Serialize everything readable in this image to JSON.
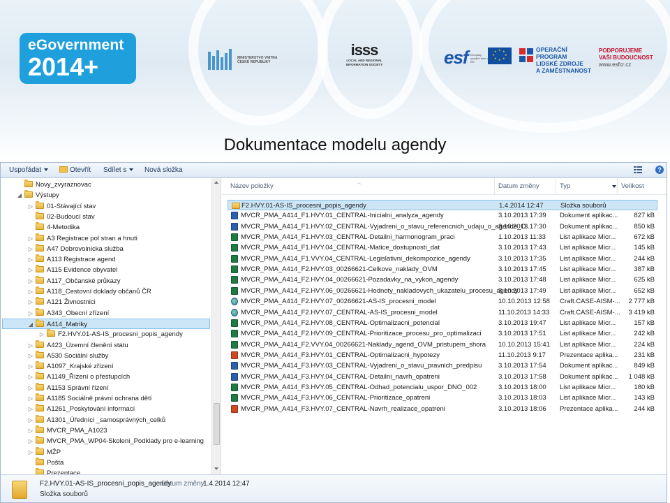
{
  "slide": {
    "title": "Dokumentace modelu agendy"
  },
  "logos": {
    "egov_line1": "eGovernment",
    "egov_line2": "2014+",
    "mvcr_text": "MINISTERSTVO VNITRA ČESKÉ REPUBLIKY",
    "isss_title": "isss",
    "isss_sub": "LOCAL AND REGIONAL INFORMATION SOCIETY",
    "esf": "esf",
    "esf_note": "evropský sociální fond v ČR",
    "eu_note": "EVROPSKÁ UNIE",
    "oplzz_line1": "OPERAČNÍ PROGRAM",
    "oplzz_line2": "LIDSKÉ ZDROJE",
    "oplzz_line3": "A ZAMĚSTNANOST",
    "podporujeme_line1": "PODPORUJEME",
    "podporujeme_line2": "VAŠI BUDOUCNOST",
    "podporujeme_web": "www.esfcr.cz"
  },
  "toolbar": {
    "organize": "Uspořádat",
    "open": "Otevřít",
    "share": "Sdílet s",
    "new_folder": "Nová složka",
    "help": "?"
  },
  "nav": {
    "items": [
      {
        "label": "Novy_zvyraznovac",
        "indent": 1,
        "arrow": "",
        "selected": false
      },
      {
        "label": "Výstupy",
        "indent": 1,
        "arrow": "◢",
        "selected": false
      },
      {
        "label": "01-Stávající stav",
        "indent": 2,
        "arrow": "▷",
        "selected": false
      },
      {
        "label": "02-Budoucí stav",
        "indent": 2,
        "arrow": "",
        "selected": false
      },
      {
        "label": "4-Metodika",
        "indent": 2,
        "arrow": "",
        "selected": false
      },
      {
        "label": "A3 Registrace pol stran a hnuti",
        "indent": 2,
        "arrow": "▷",
        "selected": false
      },
      {
        "label": "A47 Dobrovolnicka služba",
        "indent": 2,
        "arrow": "▷",
        "selected": false
      },
      {
        "label": "A113 Registrace agend",
        "indent": 2,
        "arrow": "▷",
        "selected": false
      },
      {
        "label": "A115 Evidence obyvatel",
        "indent": 2,
        "arrow": "▷",
        "selected": false
      },
      {
        "label": "A117_Občanské průkazy",
        "indent": 2,
        "arrow": "▷",
        "selected": false
      },
      {
        "label": "A118_Cestovní doklady občanů ČR",
        "indent": 2,
        "arrow": "▷",
        "selected": false
      },
      {
        "label": "A121 Živnostnici",
        "indent": 2,
        "arrow": "▷",
        "selected": false
      },
      {
        "label": "A343_Obecní zřízení",
        "indent": 2,
        "arrow": "▷",
        "selected": false
      },
      {
        "label": "A414_Matriky",
        "indent": 2,
        "arrow": "◢",
        "selected": true
      },
      {
        "label": "F2.HVY.01-AS-IS_procesni_popis_agendy",
        "indent": 3,
        "arrow": "▷",
        "selected": false
      },
      {
        "label": "A423_Územní členění státu",
        "indent": 2,
        "arrow": "▷",
        "selected": false
      },
      {
        "label": "A530 Sociální služby",
        "indent": 2,
        "arrow": "▷",
        "selected": false
      },
      {
        "label": "A1097_Krajské zřízení",
        "indent": 2,
        "arrow": "▷",
        "selected": false
      },
      {
        "label": "A1149_Řízení o přestupcích",
        "indent": 2,
        "arrow": "▷",
        "selected": false
      },
      {
        "label": "A1153 Správní řízení",
        "indent": 2,
        "arrow": "▷",
        "selected": false
      },
      {
        "label": "A1185 Sociálně právní ochrana dětí",
        "indent": 2,
        "arrow": "▷",
        "selected": false
      },
      {
        "label": "A1261_Poskytování informací",
        "indent": 2,
        "arrow": "▷",
        "selected": false
      },
      {
        "label": "A1301_Úředníci _samosprávných_celků",
        "indent": 2,
        "arrow": "▷",
        "selected": false
      },
      {
        "label": "MVCR_PMA_A1023",
        "indent": 2,
        "arrow": "▷",
        "selected": false
      },
      {
        "label": "MVCR_PMA_WP04-Skoleni_Podklady pro e-learning",
        "indent": 2,
        "arrow": "▷",
        "selected": false
      },
      {
        "label": "MŽP",
        "indent": 2,
        "arrow": "▷",
        "selected": false
      },
      {
        "label": "Pošta",
        "indent": 2,
        "arrow": "",
        "selected": false
      },
      {
        "label": "Prezentace",
        "indent": 2,
        "arrow": "",
        "selected": false
      }
    ]
  },
  "columns": {
    "name": "Název položky",
    "date": "Datum změny",
    "type": "Typ",
    "size": "Velikost"
  },
  "files": [
    {
      "name": "F2.HVY.01-AS-IS_procesni_popis_agendy",
      "date": "1.4.2014 12:47",
      "type": "Složka souborů",
      "size": "",
      "icon": "folder",
      "selected": true
    },
    {
      "name": "MVCR_PMA_A414_F1.HVY.01_CENTRAL-Inicialni_analyza_agendy",
      "date": "3.10.2013 17:39",
      "type": "Dokument aplikac...",
      "size": "827 kB",
      "icon": "doc",
      "selected": false
    },
    {
      "name": "MVCR_PMA_A414_F1.HVY.02_CENTRAL-Vyjadreni_o_stavu_referencnich_udaju_o_agende_O...",
      "date": "3.10.2013 17:30",
      "type": "Dokument aplikac...",
      "size": "850 kB",
      "icon": "doc",
      "selected": false
    },
    {
      "name": "MVCR_PMA_A414_F1.HVY.03_CENTRAL-Detailni_harmonogram_praci",
      "date": "1.10.2013 11:33",
      "type": "List aplikace Micr...",
      "size": "672 kB",
      "icon": "xls",
      "selected": false
    },
    {
      "name": "MVCR_PMA_A414_F1.HVY.04_CENTRAL-Matice_dostupnosti_dat",
      "date": "3.10.2013 17:43",
      "type": "List aplikace Micr...",
      "size": "145 kB",
      "icon": "xls",
      "selected": false
    },
    {
      "name": "MVCR_PMA_A414_F1.VVY.04_CENTRAL-Legislativni_dekompozice_agendy",
      "date": "3.10.2013 17:35",
      "type": "List aplikace Micr...",
      "size": "244 kB",
      "icon": "xls",
      "selected": false
    },
    {
      "name": "MVCR_PMA_A414_F2.HVY.03_00266621-Celkove_naklady_OVM",
      "date": "3.10.2013 17:45",
      "type": "List aplikace Micr...",
      "size": "387 kB",
      "icon": "xls",
      "selected": false
    },
    {
      "name": "MVCR_PMA_A414_F2.HVY.04_00266621-Pozadavky_na_vykon_agendy",
      "date": "3.10.2013 17:48",
      "type": "List aplikace Micr...",
      "size": "625 kB",
      "icon": "xls",
      "selected": false
    },
    {
      "name": "MVCR_PMA_A414_F2.HVY.06_00266621-Hodnoty_nakladovych_ukazatelu_procesu_agendy",
      "date": "3.10.2013 17:49",
      "type": "List aplikace Micr...",
      "size": "652 kB",
      "icon": "xls",
      "selected": false
    },
    {
      "name": "MVCR_PMA_A414_F2.HVY.07_00266621-AS-IS_procesni_model",
      "date": "10.10.2013 12:58",
      "type": "Craft.CASE-AISM-...",
      "size": "2 777 kB",
      "icon": "case",
      "selected": false
    },
    {
      "name": "MVCR_PMA_A414_F2.HVY.07_CENTRAL-AS-IS_procesni_model",
      "date": "11.10.2013 14:33",
      "type": "Craft.CASE-AISM-...",
      "size": "3 419 kB",
      "icon": "case",
      "selected": false
    },
    {
      "name": "MVCR_PMA_A414_F2.HVY.08_CENTRAL-Optimalizacni_potencial",
      "date": "3.10.2013 19:47",
      "type": "List aplikace Micr...",
      "size": "157 kB",
      "icon": "xls",
      "selected": false
    },
    {
      "name": "MVCR_PMA_A414_F2.HVY.09_CENTRAL-Prioritizace_procesu_pro_optimalizaci",
      "date": "3.10.2013 17:51",
      "type": "List aplikace Micr...",
      "size": "242 kB",
      "icon": "xls",
      "selected": false
    },
    {
      "name": "MVCR_PMA_A414_F2.VVY.04_00266621-Naklady_agend_OVM_pristupem_shora",
      "date": "10.10.2013 15:41",
      "type": "List aplikace Micr...",
      "size": "224 kB",
      "icon": "xls",
      "selected": false
    },
    {
      "name": "MVCR_PMA_A414_F3.HVY.01_CENTRAL-Optimalizacni_hypotezy",
      "date": "11.10.2013 9:17",
      "type": "Prezentace aplika...",
      "size": "231 kB",
      "icon": "ppt",
      "selected": false
    },
    {
      "name": "MVCR_PMA_A414_F3.HVY.03_CENTRAL-Vyjadreni_o_stavu_pravnich_predpisu",
      "date": "3.10.2013 17:54",
      "type": "Dokument aplikac...",
      "size": "849 kB",
      "icon": "doc",
      "selected": false
    },
    {
      "name": "MVCR_PMA_A414_F3.HVY.04_CENTRAL-Detailni_navrh_opatreni",
      "date": "3.10.2013 17:58",
      "type": "Dokument aplikac...",
      "size": "1 048 kB",
      "icon": "doc",
      "selected": false
    },
    {
      "name": "MVCR_PMA_A414_F3.HVY.05_CENTRAL-Odhad_potencialu_uspor_DNO_002",
      "date": "3.10.2013 18:00",
      "type": "List aplikace Micr...",
      "size": "180 kB",
      "icon": "xls",
      "selected": false
    },
    {
      "name": "MVCR_PMA_A414_F3.HVY.06_CENTRAL-Prioritizace_opatreni",
      "date": "3.10.2013 18:03",
      "type": "List aplikace Micr...",
      "size": "143 kB",
      "icon": "xls",
      "selected": false
    },
    {
      "name": "MVCR_PMA_A414_F3.HVY.07_CENTRAL-Navrh_realizace_opatreni",
      "date": "3.10.2013 18:06",
      "type": "Prezentace aplika...",
      "size": "244 kB",
      "icon": "ppt",
      "selected": false
    }
  ],
  "details": {
    "name": "F2.HVY.01-AS-IS_procesni_popis_agendy",
    "date_label": "Datum změny:",
    "date": "1.4.2014 12:47",
    "type": "Složka souborů"
  }
}
